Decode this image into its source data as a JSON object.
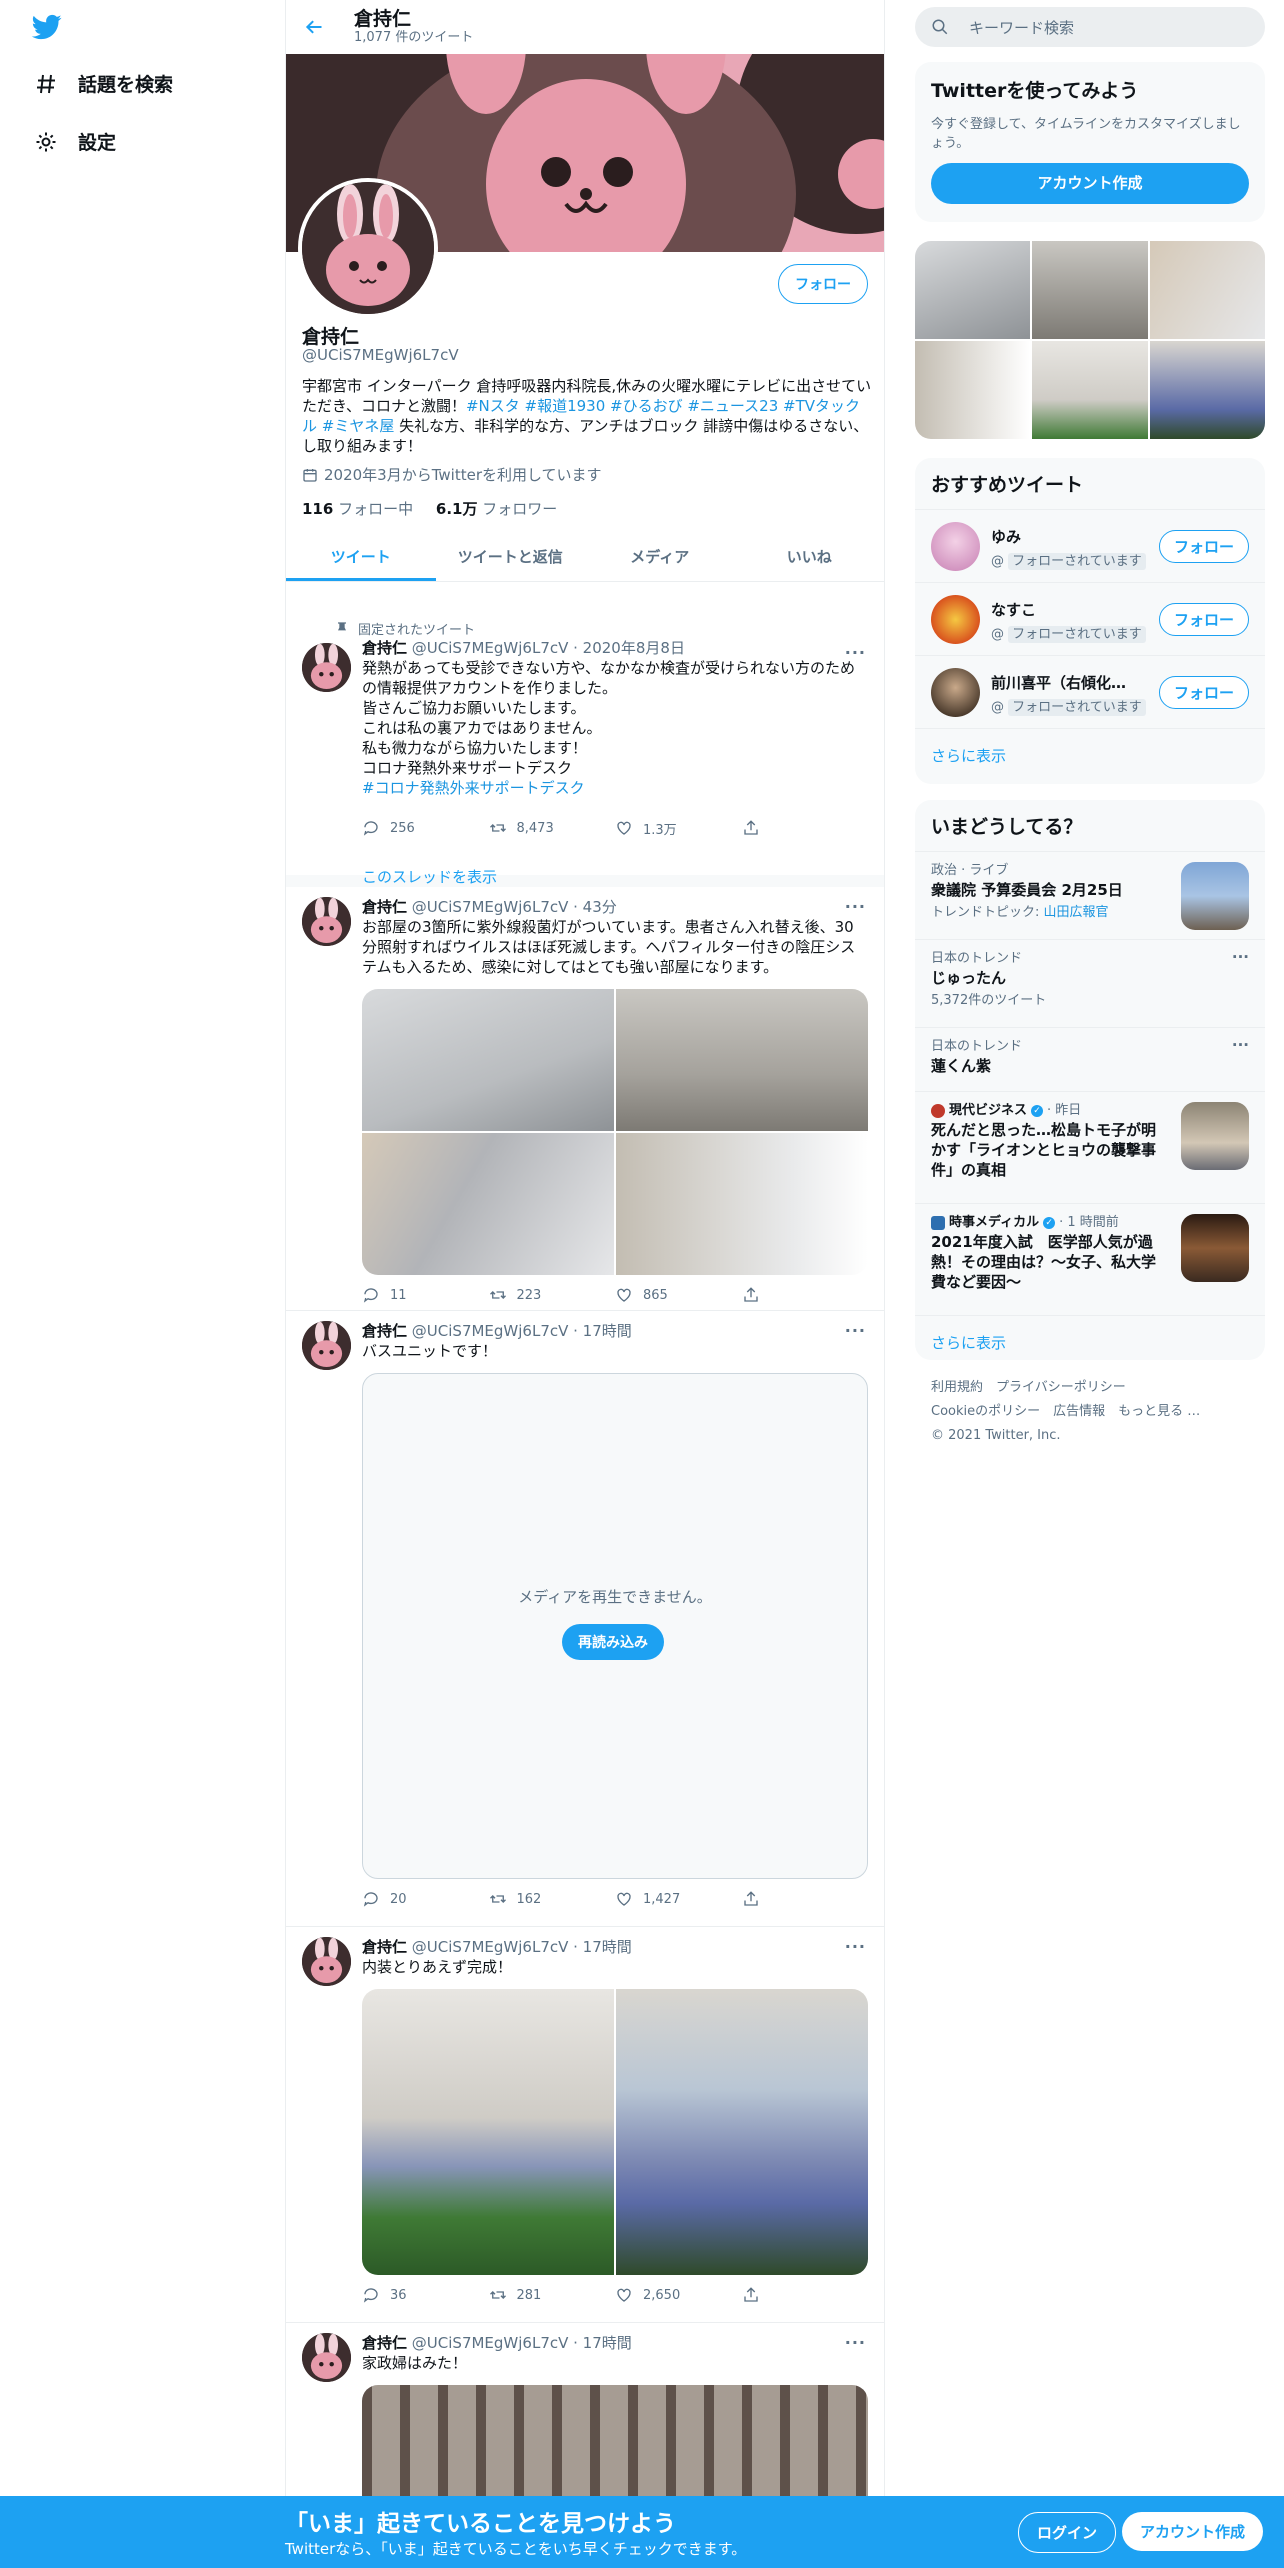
{
  "nav": {
    "explore": "話題を検索",
    "settings": "設定"
  },
  "header": {
    "name": "倉持仁",
    "count": "1,077 件のツイート"
  },
  "profile": {
    "follow": "フォロー",
    "name": "倉持仁",
    "handle": "@UCiS7MEgWj6L7cV",
    "bio_text1": "宇都宮市 インターパーク 倉持呼吸器内科院長,休みの火曜水曜にテレビに出させていただき、コロナと激闘！",
    "bio_tags": "#Nスタ #報道1930 #ひるおび #ニュース23 #TVタックル #ミヤネ屋",
    "bio_text2": " 失礼な方、非科学的な方、アンチはブロック 誹謗中傷はゆるさない、し取り組みます！",
    "joined": "2020年3月からTwitterを利用しています",
    "following_count": "116",
    "following_label": "フォロー中",
    "followers_count": "6.1万",
    "followers_label": "フォロワー"
  },
  "tabs": [
    "ツイート",
    "ツイートと返信",
    "メディア",
    "いいね"
  ],
  "tweets": [
    {
      "pinned_label": "固定されたツイート",
      "name": "倉持仁",
      "meta": "@UCiS7MEgWj6L7cV · 2020年8月8日",
      "body": "発熱があっても受診できない方や、なかなか検査が受けられない方のための情報提供アカウントを作りました。\n皆さんご協力お願いいたします。\nこれは私の裏アカではありません。\n私も微力ながら協力いたします！\nコロナ発熱外来サポートデスク",
      "tag": "#コロナ発熱外来サポートデスク",
      "replies": "256",
      "retweets": "8,473",
      "likes": "1.3万",
      "thread_link": "このスレッドを表示"
    },
    {
      "name": "倉持仁",
      "meta": "@UCiS7MEgWj6L7cV · 43分",
      "body": "お部屋の3箇所に紫外線殺菌灯がついています。患者さん入れ替え後、30分照射すればウイルスはほぼ死滅します。ヘパフィルター付きの陰圧システムも入るため、感染に対してはとても強い部屋になります。",
      "replies": "11",
      "retweets": "223",
      "likes": "865"
    },
    {
      "name": "倉持仁",
      "meta": "@UCiS7MEgWj6L7cV · 17時間",
      "body": "バスユニットです！",
      "media_error": "メディアを再生できません。",
      "reload": "再読み込み",
      "replies": "20",
      "retweets": "162",
      "likes": "1,427"
    },
    {
      "name": "倉持仁",
      "meta": "@UCiS7MEgWj6L7cV · 17時間",
      "body": "内装とりあえず完成！",
      "replies": "36",
      "retweets": "281",
      "likes": "2,650"
    },
    {
      "name": "倉持仁",
      "meta": "@UCiS7MEgWj6L7cV · 17時間",
      "body": "家政婦はみた！"
    }
  ],
  "right": {
    "search_placeholder": "キーワード検索",
    "signup_card": {
      "title": "Twitterを使ってみよう",
      "text": "今すぐ登録して、タイムラインをカスタマイズしましょう。",
      "button": "アカウント作成"
    },
    "recommend": {
      "title": "おすすめツイート",
      "items": [
        {
          "name": "ゆみ",
          "sub": "フォローされています",
          "button": "フォロー"
        },
        {
          "name": "なすこ",
          "sub": "フォローされています",
          "button": "フォロー"
        },
        {
          "name": "前川喜平（右傾化を深く憂慮する一市民）",
          "sub": "フォローされています",
          "button": "フォロー"
        }
      ],
      "more": "さらに表示"
    },
    "trends": {
      "title": "いまどうしてる？",
      "items": [
        {
          "meta": "政治 · ライブ",
          "title": "衆議院 予算委員会 2月25日",
          "sub_label": "トレンドトピック: ",
          "sub_link": "山田広報官"
        },
        {
          "meta": "日本のトレンド",
          "title": "じゅったん",
          "sub": "5,372件のツイート"
        },
        {
          "meta": "日本のトレンド",
          "title": "蓮くん紫"
        },
        {
          "source": "現代ビジネス",
          "time": "· 昨日",
          "title": "死んだと思った…松島トモ子が明かす「ライオンとヒョウの襲撃事件」の真相"
        },
        {
          "source": "時事メディカル",
          "time": "· 1 時間前",
          "title": "2021年度入試　医学部人気が過熱！その理由は？～女子、私大学費など要因～"
        }
      ],
      "more": "さらに表示"
    },
    "footer": {
      "line1a": "利用規約",
      "line1b": "プライバシーポリシー",
      "line2a": "Cookieのポリシー",
      "line2b": "広告情報",
      "line2c": "もっと見る …",
      "copyright": "© 2021 Twitter, Inc."
    }
  },
  "bottombar": {
    "title": "「いま」起きていることを見つけよう",
    "sub": "Twitterなら、「いま」起きていることをいち早くチェックできます。",
    "login": "ログイン",
    "signup": "アカウント作成"
  },
  "colors": {
    "accent": "#1da1f2",
    "banner": "#e8a7b6",
    "bunny": "#e79aaa"
  }
}
